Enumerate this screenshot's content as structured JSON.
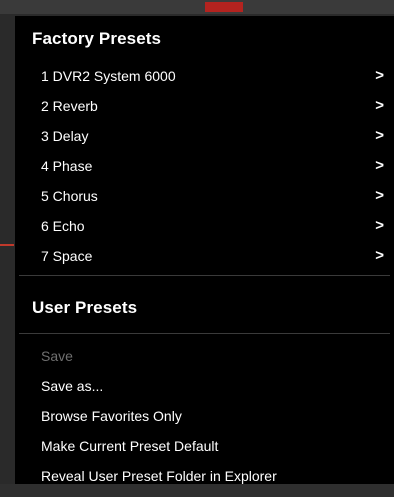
{
  "menu": {
    "factory_header": "Factory Presets",
    "factory_items": [
      {
        "label": "1 DVR2 System 6000",
        "submenu_icon": "chevron-right-icon"
      },
      {
        "label": "2 Reverb",
        "submenu_icon": "chevron-right-icon"
      },
      {
        "label": "3 Delay",
        "submenu_icon": "chevron-right-icon"
      },
      {
        "label": "4 Phase",
        "submenu_icon": "chevron-right-icon"
      },
      {
        "label": "5 Chorus",
        "submenu_icon": "chevron-right-icon"
      },
      {
        "label": "6 Echo",
        "submenu_icon": "chevron-right-icon"
      },
      {
        "label": "7 Space",
        "submenu_icon": "chevron-right-icon"
      }
    ],
    "chevron_glyph": ">",
    "user_header": "User Presets",
    "user_items": [
      {
        "label": "Save",
        "enabled": false
      },
      {
        "label": "Save as...",
        "enabled": true
      },
      {
        "label": "Browse Favorites Only",
        "enabled": true
      },
      {
        "label": "Make Current Preset Default",
        "enabled": true
      },
      {
        "label": "Reveal User Preset Folder in Explorer",
        "enabled": true
      }
    ]
  },
  "colors": {
    "menu_background": "#000000",
    "text": "#ffffff",
    "disabled_text": "#6f6f6f",
    "separator": "#3a3a3a"
  }
}
